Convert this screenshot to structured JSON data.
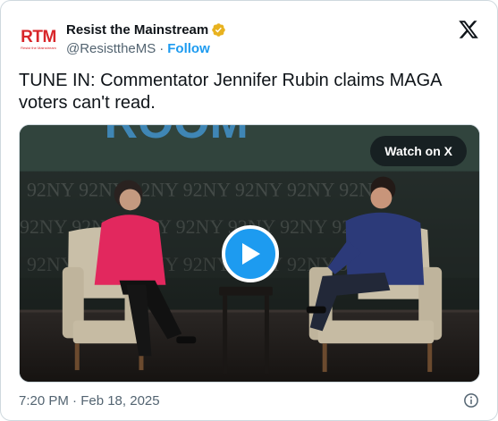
{
  "author": {
    "logo_text": "RTM",
    "logo_subtext": "Resist the Mainstream",
    "display_name": "Resist the Mainstream",
    "handle": "@ResisttheMS",
    "separator": "·",
    "follow_label": "Follow",
    "verified_color": "#e8b21f"
  },
  "tweet": {
    "text": "TUNE IN: Commentator Jennifer Rubin claims MAGA voters can't read."
  },
  "media": {
    "watch_label": "Watch on X",
    "play_color": "#1d9bf0",
    "icons": [
      "play-icon"
    ]
  },
  "footer": {
    "timestamp": "7:20 PM · Feb 18, 2025",
    "icons": [
      "info-icon"
    ]
  },
  "colors": {
    "brand_red": "#d8262a",
    "link_blue": "#1d9bf0",
    "text_secondary": "#536471"
  }
}
